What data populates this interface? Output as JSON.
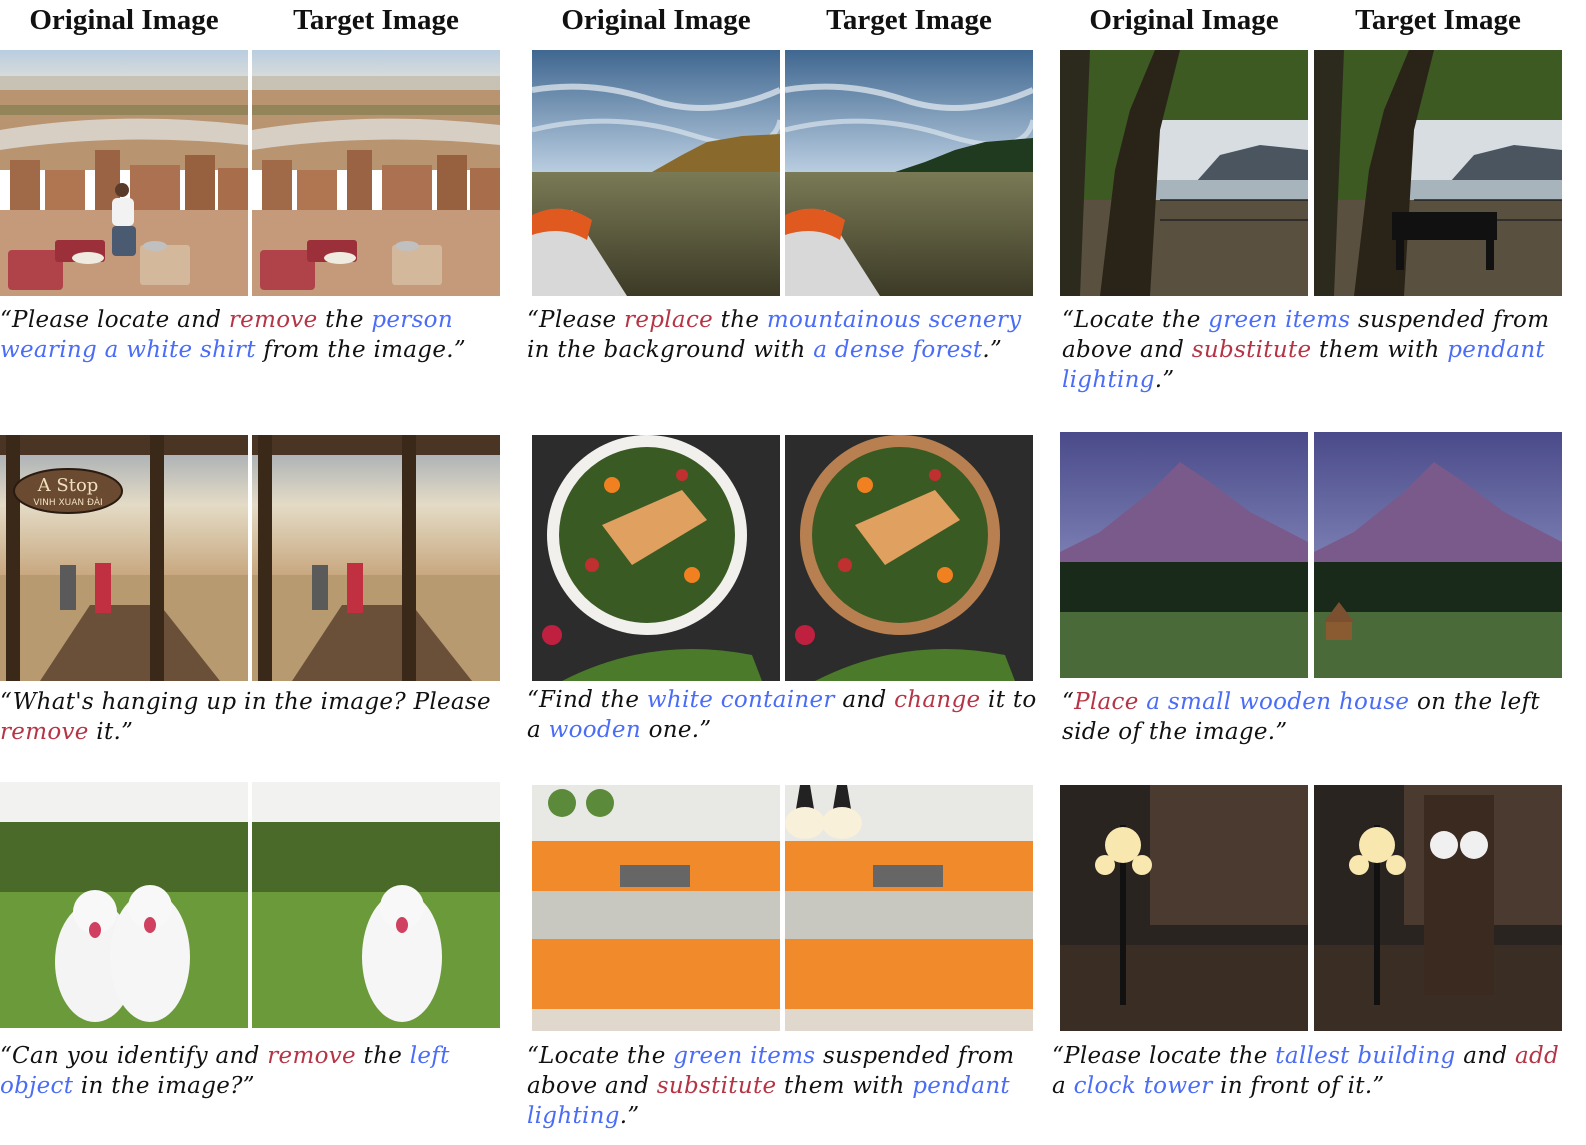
{
  "headers": {
    "original": "Original Image",
    "target": "Target Image"
  },
  "colors": {
    "blue": "#4a6cf7",
    "red": "#b53445"
  },
  "examples": [
    {
      "id": "kasbah",
      "parts": [
        {
          "t": "“Please locate and ",
          "c": "plain"
        },
        {
          "t": "remove",
          "c": "red"
        },
        {
          "t": " the ",
          "c": "plain"
        },
        {
          "t": "person wearing a white shirt",
          "c": "blue"
        },
        {
          "t": " from the image.”",
          "c": "plain"
        }
      ]
    },
    {
      "id": "lake",
      "parts": [
        {
          "t": "“Please ",
          "c": "plain"
        },
        {
          "t": "replace",
          "c": "red"
        },
        {
          "t": " the ",
          "c": "plain"
        },
        {
          "t": "mountainous scenery",
          "c": "blue"
        },
        {
          "t": " in the background with ",
          "c": "plain"
        },
        {
          "t": "a dense forest",
          "c": "blue"
        },
        {
          "t": ".”",
          "c": "plain"
        }
      ]
    },
    {
      "id": "tree",
      "parts": [
        {
          "t": "“Locate the ",
          "c": "plain"
        },
        {
          "t": "green items",
          "c": "blue"
        },
        {
          "t": " suspended from above and ",
          "c": "plain"
        },
        {
          "t": "substitute",
          "c": "red"
        },
        {
          "t": " them with ",
          "c": "plain"
        },
        {
          "t": "pendant lighting",
          "c": "blue"
        },
        {
          "t": ".”",
          "c": "plain"
        }
      ]
    },
    {
      "id": "pier",
      "parts": [
        {
          "t": "“What's hanging up in the image? Please ",
          "c": "plain"
        },
        {
          "t": "remove",
          "c": "red"
        },
        {
          "t": " it.”",
          "c": "plain"
        }
      ]
    },
    {
      "id": "salad",
      "parts": [
        {
          "t": "“Find the ",
          "c": "plain"
        },
        {
          "t": "white container",
          "c": "blue"
        },
        {
          "t": " and ",
          "c": "plain"
        },
        {
          "t": "change",
          "c": "red"
        },
        {
          "t": " it to a ",
          "c": "plain"
        },
        {
          "t": "wooden",
          "c": "blue"
        },
        {
          "t": " one.”",
          "c": "plain"
        }
      ]
    },
    {
      "id": "mountain",
      "parts": [
        {
          "t": "“",
          "c": "plain"
        },
        {
          "t": "Place",
          "c": "red"
        },
        {
          "t": " ",
          "c": "plain"
        },
        {
          "t": "a small wooden house",
          "c": "blue"
        },
        {
          "t": " on the left side of the image.”",
          "c": "plain"
        }
      ]
    },
    {
      "id": "dogs",
      "parts": [
        {
          "t": "“Can you identify and ",
          "c": "plain"
        },
        {
          "t": "remove",
          "c": "red"
        },
        {
          "t": " the ",
          "c": "plain"
        },
        {
          "t": "left object",
          "c": "blue"
        },
        {
          "t": " in the image?”",
          "c": "plain"
        }
      ]
    },
    {
      "id": "kitchen",
      "parts": [
        {
          "t": "“Locate the ",
          "c": "plain"
        },
        {
          "t": "green items",
          "c": "blue"
        },
        {
          "t": " suspended from above and ",
          "c": "plain"
        },
        {
          "t": "substitute",
          "c": "red"
        },
        {
          "t": " them with ",
          "c": "plain"
        },
        {
          "t": "pendant lighting",
          "c": "blue"
        },
        {
          "t": ".”",
          "c": "plain"
        }
      ]
    },
    {
      "id": "street",
      "parts": [
        {
          "t": "“Please locate the ",
          "c": "plain"
        },
        {
          "t": "tallest building",
          "c": "blue"
        },
        {
          "t": " and ",
          "c": "plain"
        },
        {
          "t": "add",
          "c": "red"
        },
        {
          "t": " a ",
          "c": "plain"
        },
        {
          "t": "clock tower",
          "c": "blue"
        },
        {
          "t": " in front of it.”",
          "c": "plain"
        }
      ]
    }
  ]
}
